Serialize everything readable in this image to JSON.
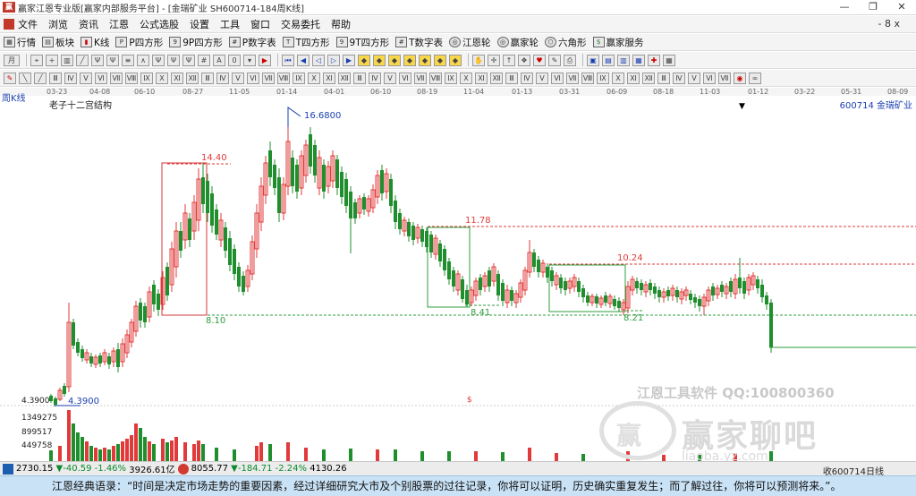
{
  "window": {
    "title": "赢家江恩专业版[赢家内部服务平台] - [金瑞矿业  SH600714-184周K线]",
    "minimize": "—",
    "restore": "❐",
    "close": "✕"
  },
  "menu": {
    "items": [
      "文件",
      "浏览",
      "资讯",
      "江恩",
      "公式选股",
      "设置",
      "工具",
      "窗口",
      "交易委托",
      "帮助"
    ],
    "right_controls": "- 8 x"
  },
  "toolbar": {
    "items": [
      "行情",
      "板块",
      "K线",
      "P四方形",
      "9P四方形",
      "P数字表",
      "T四方形",
      "9T四方形",
      "T数字表",
      "江恩轮",
      "赢家轮",
      "六角形",
      "赢家服务"
    ],
    "item_icons": [
      "table-icon",
      "grid-icon",
      "candle-icon",
      "square-icon",
      "square-icon",
      "table-icon",
      "square-icon",
      "square-icon",
      "table-icon",
      "wheel-icon",
      "wheel-icon",
      "hexagon-icon",
      "dollar-icon"
    ],
    "period_selector": "月",
    "value_selector": "0"
  },
  "chart": {
    "period_label": "周K线",
    "indicator_label": "老子十二宫结构",
    "stock_label": "600714 金瑞矿业",
    "time_axis": [
      "03-23",
      "04-08",
      "06-10",
      "08-27",
      "11-05",
      "01-14",
      "04-01",
      "06-10",
      "08-19",
      "11-04",
      "01-13",
      "03-31",
      "06-09",
      "08-18",
      "11-03",
      "01-12",
      "03-22",
      "05-31",
      "08-09"
    ],
    "price_labels": {
      "high": "16.6800",
      "p1440": "14.40",
      "p1178": "11.78",
      "p1024": "10.24",
      "p810": "8.10",
      "p841": "8.41",
      "p821": "8.21",
      "low": "4.3900",
      "low_axis": "4.3900",
      "dollar": "$"
    },
    "volume_axis": [
      "1349275",
      "899517",
      "449758"
    ],
    "watermark_top": "江恩工具软件  QQ:100800360",
    "watermark_brand": "赢家聊吧",
    "watermark_sub": "liaoba.yz.com",
    "colors": {
      "up": "#e23a3a",
      "down": "#1f8f2e",
      "box": "#d43434",
      "box2": "#2e9d3e",
      "dashed_red": "#e23a3a",
      "dashed_green": "#2e9d3e",
      "label_blue": "#1a3fb0"
    }
  },
  "status": {
    "sh_index": "2730.15",
    "sh_change": "▼-40.59",
    "sh_pct": "-1.46%",
    "sh_amount": "3926.61亿",
    "sz_index": "8055.77",
    "sz_change": "▼-184.71",
    "sz_pct": "-2.24%",
    "sz_amount": "4130.26",
    "right_text": "收600714日线"
  },
  "quote": {
    "text": "江恩经典语录：“时间是决定市场走势的重要因素，经过详细研究大市及个别股票的过往记录，你将可以证明，历史确实重复发生；而了解过往，你将可以预测将来。”。"
  }
}
